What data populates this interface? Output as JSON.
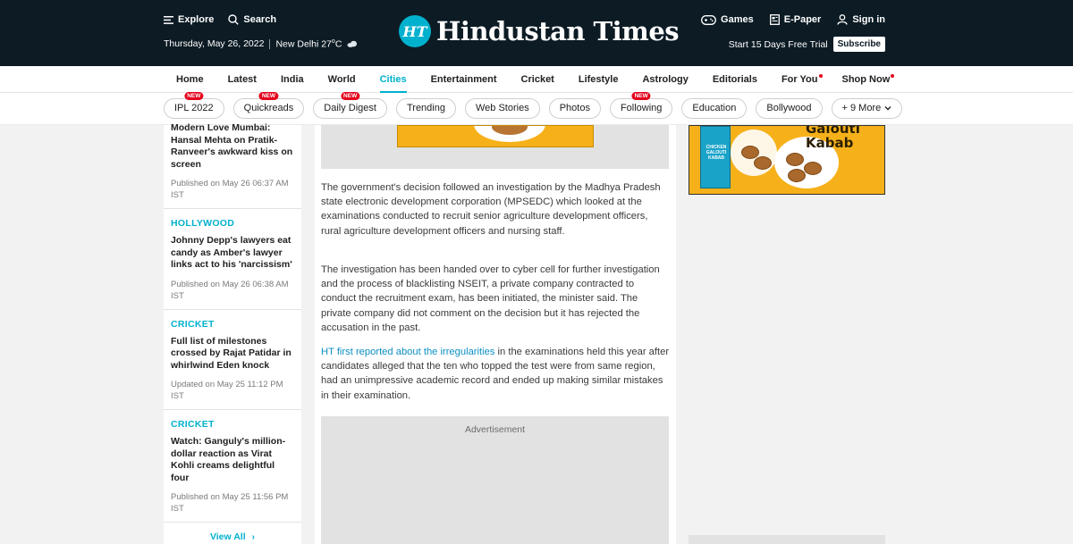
{
  "header": {
    "explore": "Explore",
    "search": "Search",
    "date": "Thursday, May 26, 2022",
    "location_temp": "New Delhi 27",
    "temp_unit": "o",
    "temp_c": "C",
    "logo_mark": "HT",
    "logo_text": "Hindustan Times",
    "games": "Games",
    "epaper": "E-Paper",
    "signin": "Sign in",
    "trial": "Start 15 Days Free Trial",
    "subscribe": "Subscribe"
  },
  "nav": {
    "items": [
      {
        "label": "Home"
      },
      {
        "label": "Latest"
      },
      {
        "label": "India"
      },
      {
        "label": "World"
      },
      {
        "label": "Cities",
        "active": true
      },
      {
        "label": "Entertainment"
      },
      {
        "label": "Cricket"
      },
      {
        "label": "Lifestyle"
      },
      {
        "label": "Astrology"
      },
      {
        "label": "Editorials"
      },
      {
        "label": "For You",
        "dot": true
      },
      {
        "label": "Shop Now",
        "dot": true
      }
    ]
  },
  "chips": {
    "new_label": "NEW",
    "more_label": "+ 9 More",
    "items": [
      {
        "label": "IPL 2022",
        "new": true
      },
      {
        "label": "Quickreads",
        "new": true
      },
      {
        "label": "Daily Digest",
        "new": true
      },
      {
        "label": "Trending"
      },
      {
        "label": "Web Stories"
      },
      {
        "label": "Photos"
      },
      {
        "label": "Following",
        "new": true
      },
      {
        "label": "Education"
      },
      {
        "label": "Bollywood"
      }
    ]
  },
  "sidebar": {
    "partial": {
      "title": "Modern Love Mumbai: Hansal Mehta on Pratik-Ranveer's awkward kiss on screen",
      "date": "Published on May 26 06:37 AM IST"
    },
    "stories": [
      {
        "category": "HOLLYWOOD",
        "title": "Johnny Depp's lawyers eat candy as Amber's lawyer links act to his 'narcissism'",
        "date": "Published on May 26 06:38 AM IST"
      },
      {
        "category": "CRICKET",
        "title": "Full list of milestones crossed by Rajat Patidar in whirlwind Eden knock",
        "date": "Updated on May 25 11:12 PM IST"
      },
      {
        "category": "CRICKET",
        "title": "Watch: Ganguly's million-dollar reaction as Virat Kohli creams delightful four",
        "date": "Published on May 25 11:56 PM IST"
      }
    ],
    "view_all": "View All"
  },
  "article": {
    "p1": "The government's decision followed an investigation by the Madhya Pradesh state electronic development corporation (MPSEDC) which looked at the examinations conducted to recruit senior agriculture development officers, rural agriculture development officers and nursing staff.",
    "p2": "The investigation has been handed over to cyber cell for further investigation and the process of blacklisting NSEIT, a private company contracted to conduct the recruitment exam, has been initiated, the minister said. The private company did not comment on the decision but it has rejected the accusation in the past.",
    "p3_link": "HT first reported about the irregularities",
    "p3_rest": " in the examinations held this year after candidates alleged that the ten who topped the test were from same region, had an unimpressive academic record and ended up making similar mistakes in their examination.",
    "ad_label": "Advertisement"
  },
  "right_ad": {
    "headline_1": "Galouti",
    "headline_2": "Kabab",
    "box_text": "CHICKEN GALOUTI KABAB"
  },
  "colors": {
    "header_bg": "#0c1b24",
    "accent": "#00b1cd",
    "new_badge": "#e4001b",
    "link": "#0c8fc4"
  }
}
